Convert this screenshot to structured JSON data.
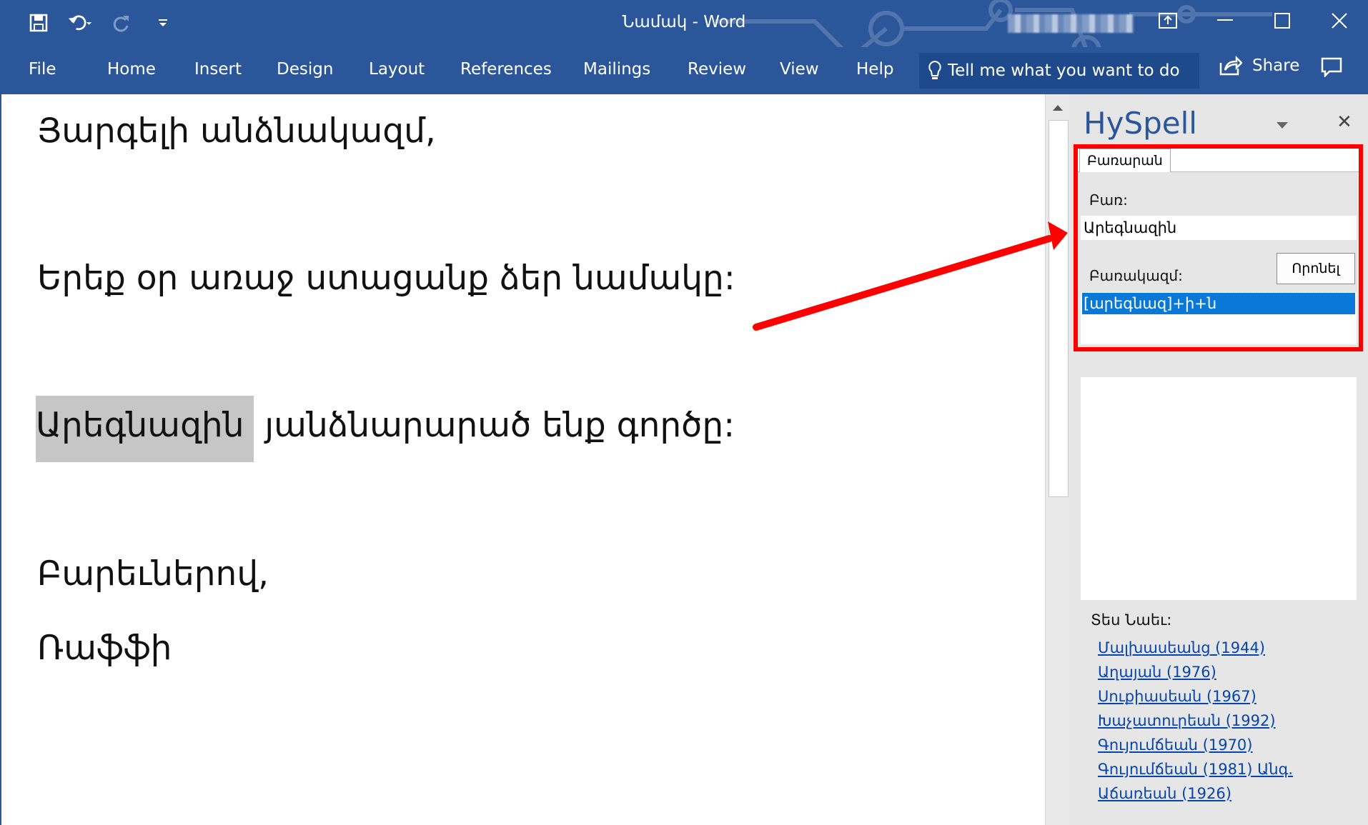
{
  "window": {
    "title": "Նամակ  -  Word",
    "user_name_blurred": ""
  },
  "ribbon": {
    "tabs": [
      "File",
      "Home",
      "Insert",
      "Design",
      "Layout",
      "References",
      "Mailings",
      "Review",
      "View",
      "Help"
    ],
    "tell_me": "Tell me what you want to do",
    "share": "Share"
  },
  "document": {
    "salutation": "Յարգելի անձնակազմ,",
    "line1": "Երեք օր առաջ ստացանք ձեր նամակը:",
    "highlighted_word": "Արեգնազին",
    "line2_rest": " յանձնարարած ենք գործը:",
    "closing": "Բարեւներով,",
    "signature": "Ռաֆֆի"
  },
  "hyspell": {
    "title": "HySpell",
    "tab": "Բառարան",
    "word_label": "Բառ:",
    "word_value": "Արեգնազին",
    "find_button": "Որոնել",
    "morph_label": "Բառակազմ:",
    "morph_selected": "[արեգնազ]+ի+ն",
    "see_also_label": "Տես Նաեւ:",
    "see_also": [
      "Մալխասեանց (1944)",
      "Աղայան (1976)",
      "Սուքիասեան (1967)",
      "Խաչատուրեան (1992)",
      "Գույումճեան (1970)",
      "Գույումճեան (1981) Անգ.",
      "Աճառեան (1926)"
    ]
  },
  "colors": {
    "ribbon": "#2b579a",
    "annotation": "#ff0000",
    "selection": "#0a78d7"
  }
}
